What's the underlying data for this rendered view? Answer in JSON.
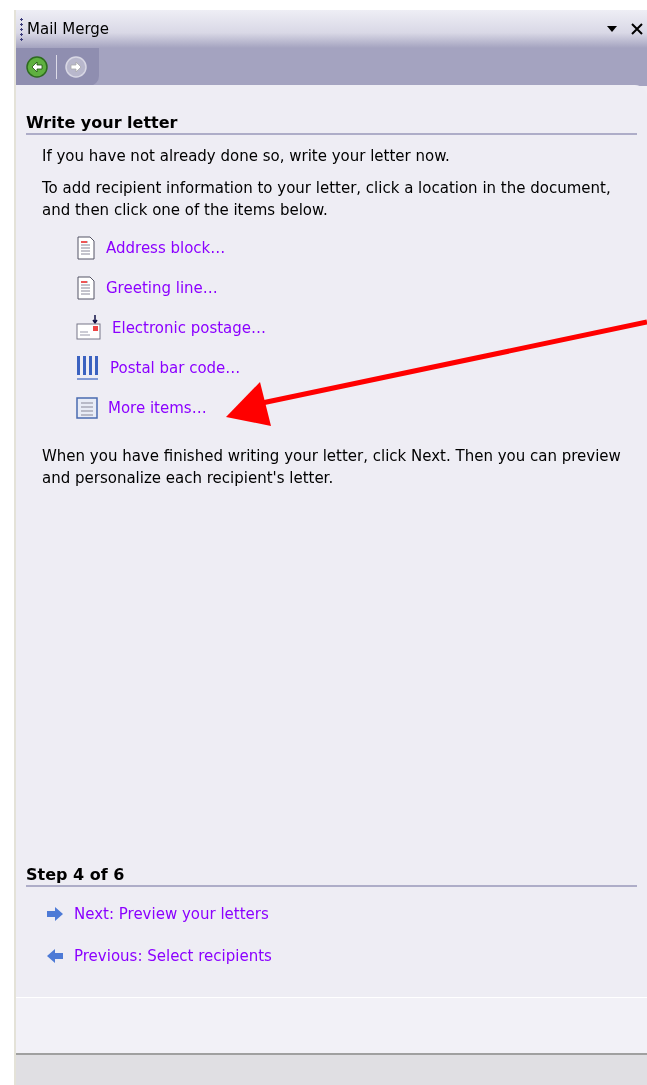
{
  "window": {
    "title": "Mail Merge"
  },
  "navigation": [
    {
      "kind": "back",
      "disabled": false
    },
    {
      "kind": "forward",
      "disabled": true
    }
  ],
  "section": {
    "heading": "Write your letter",
    "paragraphs": [
      "If you have not already done so, write your letter now.",
      "To add recipient information to your letter, click a location in the document, and then click one of the items below."
    ],
    "items": [
      {
        "kind": "document",
        "label": "Address block…"
      },
      {
        "kind": "document",
        "label": "Greeting line…"
      },
      {
        "kind": "postage",
        "label": "Electronic postage…"
      },
      {
        "kind": "barcode",
        "label": "Postal bar code…"
      },
      {
        "kind": "list",
        "label": "More items…"
      }
    ],
    "closing": "When you have finished writing your letter, click Next. Then you can preview and personalize each recipient's letter."
  },
  "step": {
    "heading": "Step 4 of 6",
    "links": [
      {
        "kind": "next",
        "label": "Next: Preview your letters"
      },
      {
        "kind": "previous",
        "label": "Previous: Select recipients"
      }
    ]
  }
}
